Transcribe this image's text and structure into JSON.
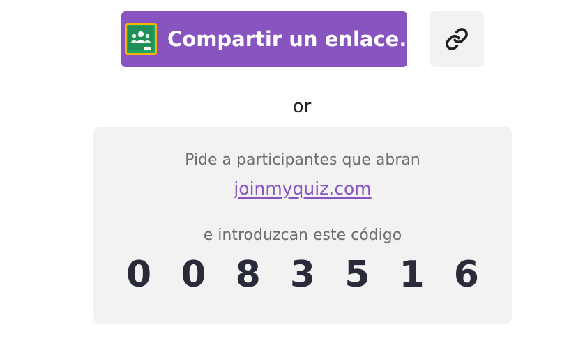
{
  "share": {
    "label": "Compartir un enlace...",
    "logo_icon": "google-classroom-icon",
    "color": "#8854c0"
  },
  "copy_link": {
    "icon": "link-icon"
  },
  "separator": {
    "text": "or"
  },
  "join_panel": {
    "instruction_top": "Pide a participantes que abran",
    "link_text": "joinmyquiz.com",
    "instruction_bottom": "e introduzcan este código",
    "code": "0 0 8 3 5 1 6"
  }
}
